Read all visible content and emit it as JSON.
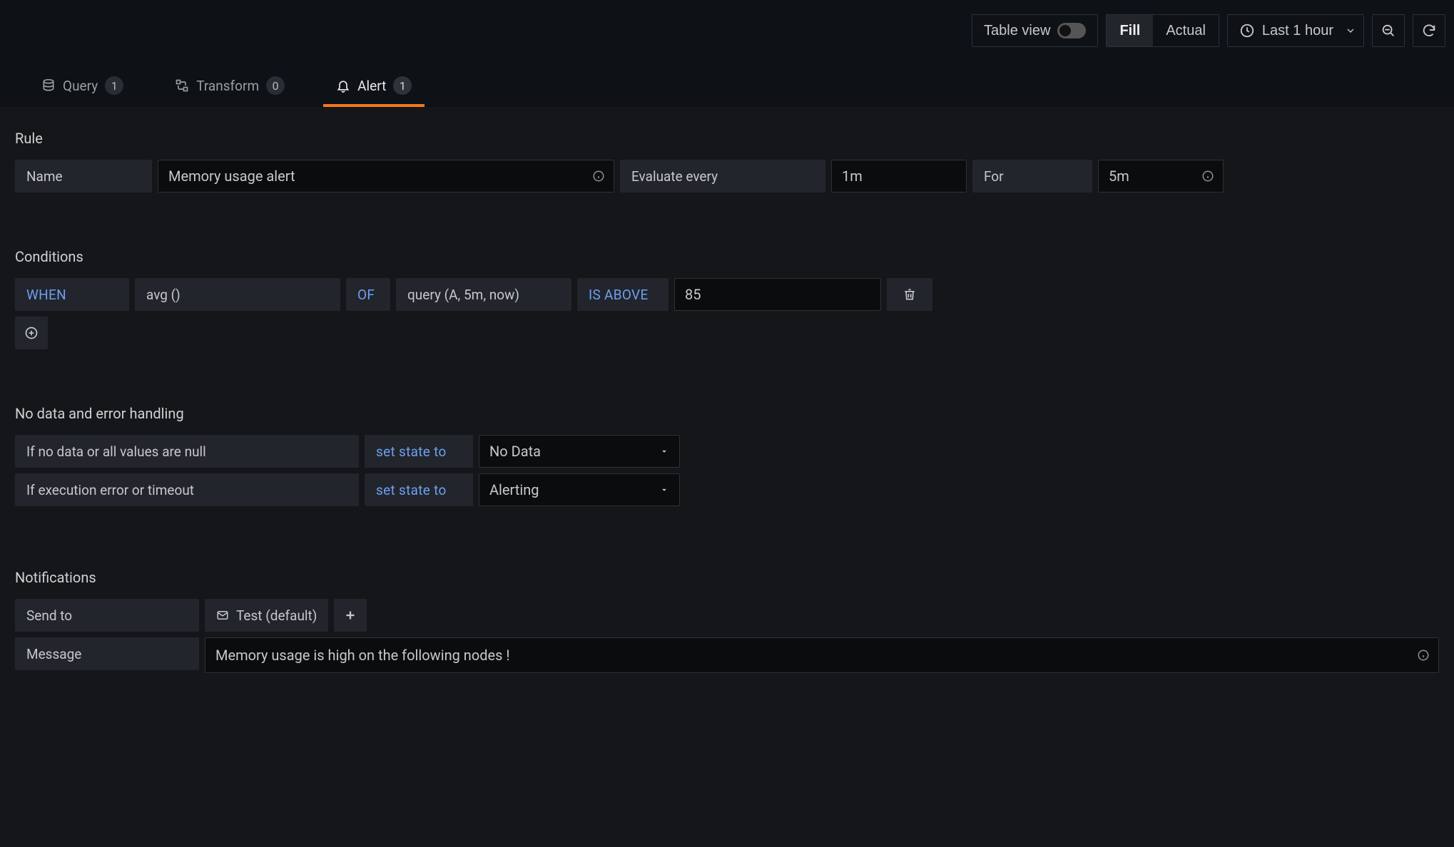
{
  "toolbar": {
    "tableViewLabel": "Table view",
    "fillLabel": "Fill",
    "actualLabel": "Actual",
    "timeRangeLabel": "Last 1 hour"
  },
  "tabs": {
    "query": {
      "label": "Query",
      "count": "1"
    },
    "transform": {
      "label": "Transform",
      "count": "0"
    },
    "alert": {
      "label": "Alert",
      "count": "1"
    }
  },
  "alert": {
    "rule": {
      "sectionTitle": "Rule",
      "nameLabel": "Name",
      "nameValue": "Memory usage alert",
      "evaluateLabel": "Evaluate every",
      "evaluateValue": "1m",
      "forLabel": "For",
      "forValue": "5m"
    },
    "conditions": {
      "sectionTitle": "Conditions",
      "when": "WHEN",
      "agg": "avg ()",
      "of": "OF",
      "query": "query (A, 5m, now)",
      "isAbove": "IS ABOVE",
      "threshold": "85"
    },
    "noDataHandling": {
      "sectionTitle": "No data and error handling",
      "row1Label": "If no data or all values are null",
      "row2Label": "If execution error or timeout",
      "setStateTo": "set state to",
      "noDataState": "No Data",
      "errorState": "Alerting"
    },
    "notifications": {
      "sectionTitle": "Notifications",
      "sendToLabel": "Send to",
      "channelLabel": "Test (default)",
      "messageLabel": "Message",
      "messageValue": "Memory usage is high on the following nodes !"
    }
  }
}
